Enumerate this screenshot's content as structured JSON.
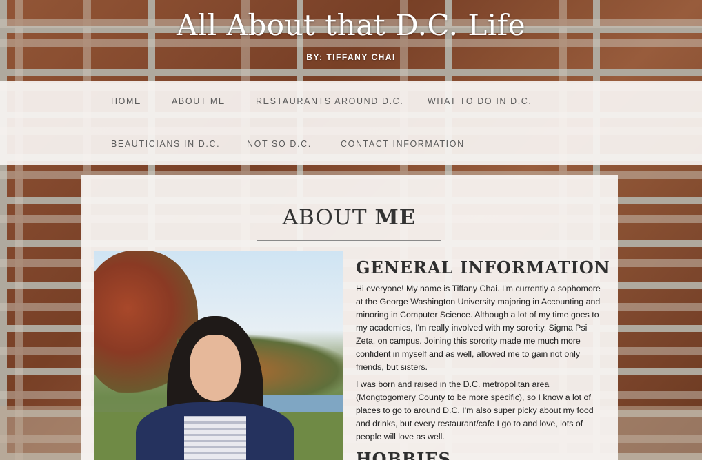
{
  "header": {
    "title": "All About that D.C. Life",
    "byline": "BY: TIFFANY CHAI"
  },
  "nav": {
    "items": [
      {
        "label": "HOME"
      },
      {
        "label": "ABOUT ME"
      },
      {
        "label": "RESTAURANTS AROUND D.C."
      },
      {
        "label": "WHAT TO DO IN D.C."
      },
      {
        "label": "BEAUTICIANS IN D.C."
      },
      {
        "label": "NOT SO D.C."
      },
      {
        "label": "CONTACT INFORMATION"
      }
    ]
  },
  "main": {
    "title_light": "ABOUT ",
    "title_bold": "ME",
    "sections": [
      {
        "heading": "GENERAL INFORMATION",
        "paragraphs": [
          "Hi everyone! My name is Tiffany Chai. I'm currently a sophomore at the George Washington University majoring in Accounting and minoring in Computer Science. Although a lot of my time goes to my academics, I'm really involved with my sorority, Sigma Psi Zeta, on campus. Joining this sorority made me much more confident in myself and as well, allowed me to gain not only friends, but sisters.",
          "I was born and raised in the D.C. metropolitan area (Mongtogomery County to be more specific), so I know a lot of places to go to around D.C. I'm also super picky about my food and drinks, but every restaurant/cafe I go to and love, lots of people will love as well."
        ]
      },
      {
        "heading": "HOBBIES"
      }
    ]
  },
  "colors": {
    "nav_background": "#f8f4f2",
    "nav_text": "#5b5b5b",
    "header_text": "#ffffff",
    "heading_text": "#2f2f2f"
  }
}
